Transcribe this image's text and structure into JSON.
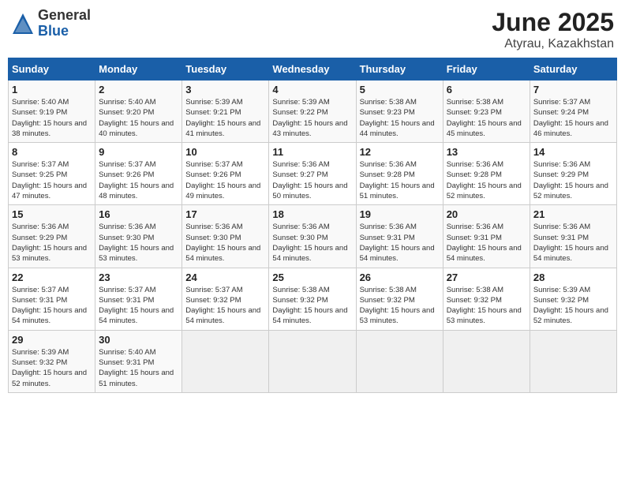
{
  "header": {
    "logo_general": "General",
    "logo_blue": "Blue",
    "title": "June 2025",
    "location": "Atyrau, Kazakhstan"
  },
  "calendar": {
    "days_of_week": [
      "Sunday",
      "Monday",
      "Tuesday",
      "Wednesday",
      "Thursday",
      "Friday",
      "Saturday"
    ],
    "weeks": [
      [
        null,
        {
          "day": "2",
          "sunrise": "5:40 AM",
          "sunset": "9:20 PM",
          "daylight": "15 hours and 40 minutes."
        },
        {
          "day": "3",
          "sunrise": "5:39 AM",
          "sunset": "9:21 PM",
          "daylight": "15 hours and 41 minutes."
        },
        {
          "day": "4",
          "sunrise": "5:39 AM",
          "sunset": "9:22 PM",
          "daylight": "15 hours and 43 minutes."
        },
        {
          "day": "5",
          "sunrise": "5:38 AM",
          "sunset": "9:23 PM",
          "daylight": "15 hours and 44 minutes."
        },
        {
          "day": "6",
          "sunrise": "5:38 AM",
          "sunset": "9:23 PM",
          "daylight": "15 hours and 45 minutes."
        },
        {
          "day": "7",
          "sunrise": "5:37 AM",
          "sunset": "9:24 PM",
          "daylight": "15 hours and 46 minutes."
        }
      ],
      [
        {
          "day": "1",
          "sunrise": "5:40 AM",
          "sunset": "9:19 PM",
          "daylight": "15 hours and 38 minutes."
        },
        {
          "day": "8",
          "sunrise": "5:37 AM",
          "sunset": "9:25 PM",
          "daylight": "15 hours and 47 minutes."
        },
        {
          "day": "9",
          "sunrise": "5:37 AM",
          "sunset": "9:26 PM",
          "daylight": "15 hours and 48 minutes."
        },
        {
          "day": "10",
          "sunrise": "5:37 AM",
          "sunset": "9:26 PM",
          "daylight": "15 hours and 49 minutes."
        },
        {
          "day": "11",
          "sunrise": "5:36 AM",
          "sunset": "9:27 PM",
          "daylight": "15 hours and 50 minutes."
        },
        {
          "day": "12",
          "sunrise": "5:36 AM",
          "sunset": "9:28 PM",
          "daylight": "15 hours and 51 minutes."
        },
        {
          "day": "13",
          "sunrise": "5:36 AM",
          "sunset": "9:28 PM",
          "daylight": "15 hours and 52 minutes."
        },
        {
          "day": "14",
          "sunrise": "5:36 AM",
          "sunset": "9:29 PM",
          "daylight": "15 hours and 52 minutes."
        }
      ],
      [
        {
          "day": "15",
          "sunrise": "5:36 AM",
          "sunset": "9:29 PM",
          "daylight": "15 hours and 53 minutes."
        },
        {
          "day": "16",
          "sunrise": "5:36 AM",
          "sunset": "9:30 PM",
          "daylight": "15 hours and 53 minutes."
        },
        {
          "day": "17",
          "sunrise": "5:36 AM",
          "sunset": "9:30 PM",
          "daylight": "15 hours and 54 minutes."
        },
        {
          "day": "18",
          "sunrise": "5:36 AM",
          "sunset": "9:30 PM",
          "daylight": "15 hours and 54 minutes."
        },
        {
          "day": "19",
          "sunrise": "5:36 AM",
          "sunset": "9:31 PM",
          "daylight": "15 hours and 54 minutes."
        },
        {
          "day": "20",
          "sunrise": "5:36 AM",
          "sunset": "9:31 PM",
          "daylight": "15 hours and 54 minutes."
        },
        {
          "day": "21",
          "sunrise": "5:36 AM",
          "sunset": "9:31 PM",
          "daylight": "15 hours and 54 minutes."
        }
      ],
      [
        {
          "day": "22",
          "sunrise": "5:37 AM",
          "sunset": "9:31 PM",
          "daylight": "15 hours and 54 minutes."
        },
        {
          "day": "23",
          "sunrise": "5:37 AM",
          "sunset": "9:31 PM",
          "daylight": "15 hours and 54 minutes."
        },
        {
          "day": "24",
          "sunrise": "5:37 AM",
          "sunset": "9:32 PM",
          "daylight": "15 hours and 54 minutes."
        },
        {
          "day": "25",
          "sunrise": "5:38 AM",
          "sunset": "9:32 PM",
          "daylight": "15 hours and 54 minutes."
        },
        {
          "day": "26",
          "sunrise": "5:38 AM",
          "sunset": "9:32 PM",
          "daylight": "15 hours and 53 minutes."
        },
        {
          "day": "27",
          "sunrise": "5:38 AM",
          "sunset": "9:32 PM",
          "daylight": "15 hours and 53 minutes."
        },
        {
          "day": "28",
          "sunrise": "5:39 AM",
          "sunset": "9:32 PM",
          "daylight": "15 hours and 52 minutes."
        }
      ],
      [
        {
          "day": "29",
          "sunrise": "5:39 AM",
          "sunset": "9:32 PM",
          "daylight": "15 hours and 52 minutes."
        },
        {
          "day": "30",
          "sunrise": "5:40 AM",
          "sunset": "9:31 PM",
          "daylight": "15 hours and 51 minutes."
        },
        null,
        null,
        null,
        null,
        null
      ]
    ]
  }
}
